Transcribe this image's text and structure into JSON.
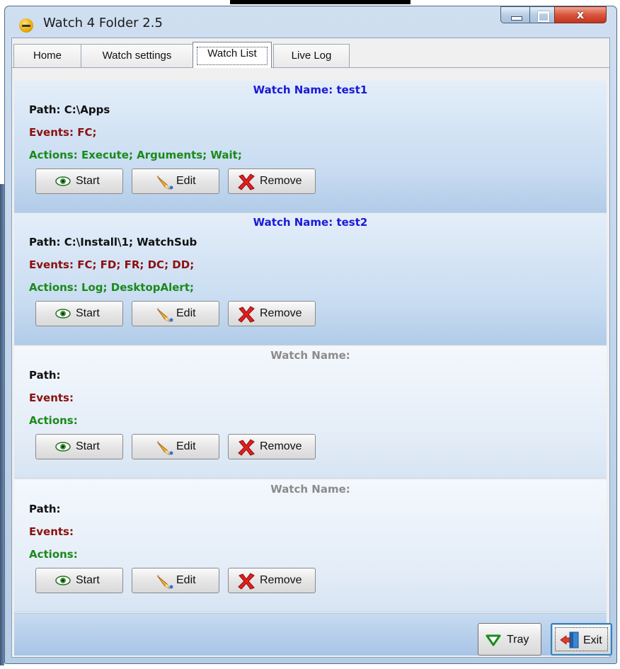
{
  "window": {
    "title": "Watch 4 Folder 2.5",
    "controls": {
      "close_glyph": "x"
    }
  },
  "tabs": [
    {
      "label": "Home",
      "active": false
    },
    {
      "label": "Watch settings",
      "active": false
    },
    {
      "label": "Watch List",
      "active": true
    },
    {
      "label": "Live Log",
      "active": false
    }
  ],
  "watches": [
    {
      "name_line": "Watch Name: test1",
      "path_line": "Path: C:\\Apps",
      "events_line": "Events: FC;",
      "actions_line": "Actions: Execute; Arguments; Wait;",
      "start_label": "Start",
      "edit_label": "Edit",
      "remove_label": "Remove"
    },
    {
      "name_line": "Watch Name: test2",
      "path_line": "Path: C:\\Install\\1; WatchSub",
      "events_line": "Events: FC; FD; FR; DC; DD;",
      "actions_line": "Actions: Log; DesktopAlert;",
      "start_label": "Start",
      "edit_label": "Edit",
      "remove_label": "Remove"
    },
    {
      "name_line": "Watch Name:",
      "path_line": "Path:",
      "events_line": "Events:",
      "actions_line": "Actions:",
      "start_label": "Start",
      "edit_label": "Edit",
      "remove_label": "Remove"
    },
    {
      "name_line": "Watch Name:",
      "path_line": "Path:",
      "events_line": "Events:",
      "actions_line": "Actions:",
      "start_label": "Start",
      "edit_label": "Edit",
      "remove_label": "Remove"
    }
  ],
  "footer": {
    "tray_label": "Tray",
    "exit_label": "Exit"
  },
  "colors": {
    "watch_name_active": "#1a1ad6",
    "watch_name_empty": "#8b8b8b",
    "events": "#8b1010",
    "actions": "#1a8a1a"
  },
  "icons": {
    "start": "eye-icon",
    "edit": "pencil-icon",
    "remove": "red-x-icon",
    "tray": "green-triangle-down-icon",
    "exit": "exit-door-icon"
  }
}
